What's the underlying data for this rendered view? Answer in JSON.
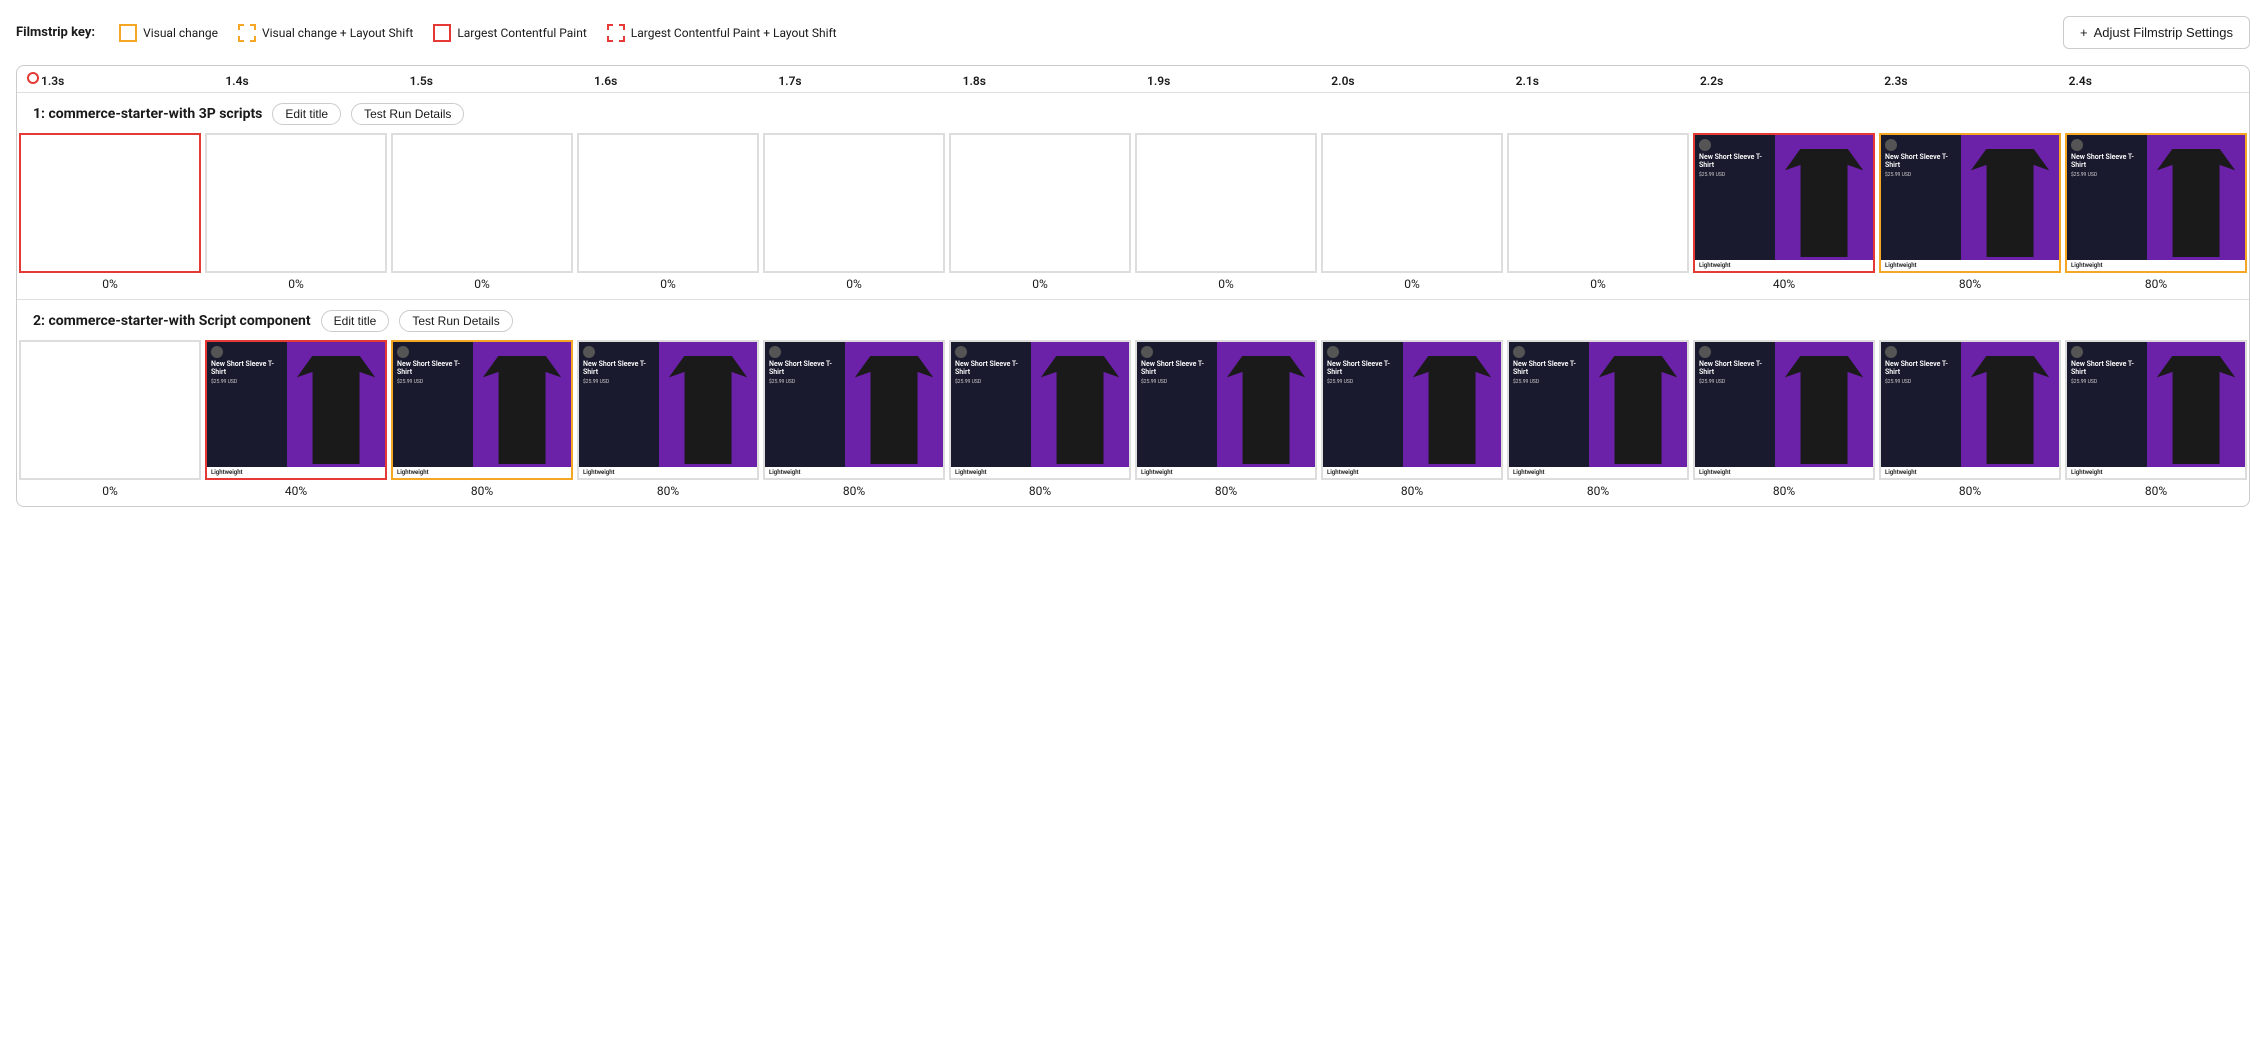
{
  "legend": {
    "key_label": "Filmstrip key:",
    "items": [
      {
        "id": "visual-change",
        "label": "Visual change",
        "type": "visual-change"
      },
      {
        "id": "visual-change-layout",
        "label": "Visual change + Layout Shift",
        "type": "visual-change-layout"
      },
      {
        "id": "lcp",
        "label": "Largest Contentful Paint",
        "type": "lcp"
      },
      {
        "id": "lcp-layout",
        "label": "Largest Contentful Paint + Layout Shift",
        "type": "lcp-layout"
      }
    ]
  },
  "adjust_btn": {
    "label": "Adjust Filmstrip Settings",
    "icon": "+"
  },
  "timeline": {
    "ticks": [
      "1.3s",
      "1.4s",
      "1.5s",
      "1.6s",
      "1.7s",
      "1.8s",
      "1.9s",
      "2.0s",
      "2.1s",
      "2.2s",
      "2.3s",
      "2.4s"
    ]
  },
  "rows": [
    {
      "id": "row1",
      "title": "1: commerce-starter-with 3P scripts",
      "edit_btn": "Edit title",
      "details_btn": "Test Run Details",
      "frames": [
        {
          "border": "red",
          "empty": true,
          "percent": "0%"
        },
        {
          "border": "none",
          "empty": true,
          "percent": "0%"
        },
        {
          "border": "none",
          "empty": true,
          "percent": "0%"
        },
        {
          "border": "none",
          "empty": true,
          "percent": "0%"
        },
        {
          "border": "none",
          "empty": true,
          "percent": "0%"
        },
        {
          "border": "none",
          "empty": true,
          "percent": "0%"
        },
        {
          "border": "none",
          "empty": true,
          "percent": "0%"
        },
        {
          "border": "none",
          "empty": true,
          "percent": "0%"
        },
        {
          "border": "none",
          "empty": true,
          "percent": "0%"
        },
        {
          "border": "red",
          "empty": false,
          "percent": "40%",
          "badge": "Lightweight"
        },
        {
          "border": "orange",
          "empty": false,
          "percent": "80%",
          "badge": "Lightweight"
        },
        {
          "border": "orange",
          "empty": false,
          "percent": "80%",
          "badge": "Lightweight"
        }
      ]
    },
    {
      "id": "row2",
      "title": "2: commerce-starter-with Script component",
      "edit_btn": "Edit title",
      "details_btn": "Test Run Details",
      "frames": [
        {
          "border": "none",
          "empty": true,
          "percent": "0%"
        },
        {
          "border": "red",
          "empty": false,
          "percent": "40%",
          "badge": "Lightweight"
        },
        {
          "border": "orange",
          "empty": false,
          "percent": "80%",
          "badge": "Lightweight"
        },
        {
          "border": "none",
          "empty": false,
          "percent": "80%",
          "badge": "Lightweight"
        },
        {
          "border": "none",
          "empty": false,
          "percent": "80%",
          "badge": "Lightweight"
        },
        {
          "border": "none",
          "empty": false,
          "percent": "80%",
          "badge": "Lightweight"
        },
        {
          "border": "none",
          "empty": false,
          "percent": "80%",
          "badge": "Lightweight"
        },
        {
          "border": "none",
          "empty": false,
          "percent": "80%",
          "badge": "Lightweight"
        },
        {
          "border": "none",
          "empty": false,
          "percent": "80%",
          "badge": "Lightweight"
        },
        {
          "border": "none",
          "empty": false,
          "percent": "80%",
          "badge": "Lightweight"
        },
        {
          "border": "none",
          "empty": false,
          "percent": "80%",
          "badge": "Lightweight"
        },
        {
          "border": "none",
          "empty": false,
          "percent": "80%",
          "badge": "Lightweight"
        }
      ]
    }
  ],
  "product": {
    "title": "New Short Sleeve T-Shirt",
    "price": "$25.99 USD",
    "badge": "Lightweight"
  }
}
